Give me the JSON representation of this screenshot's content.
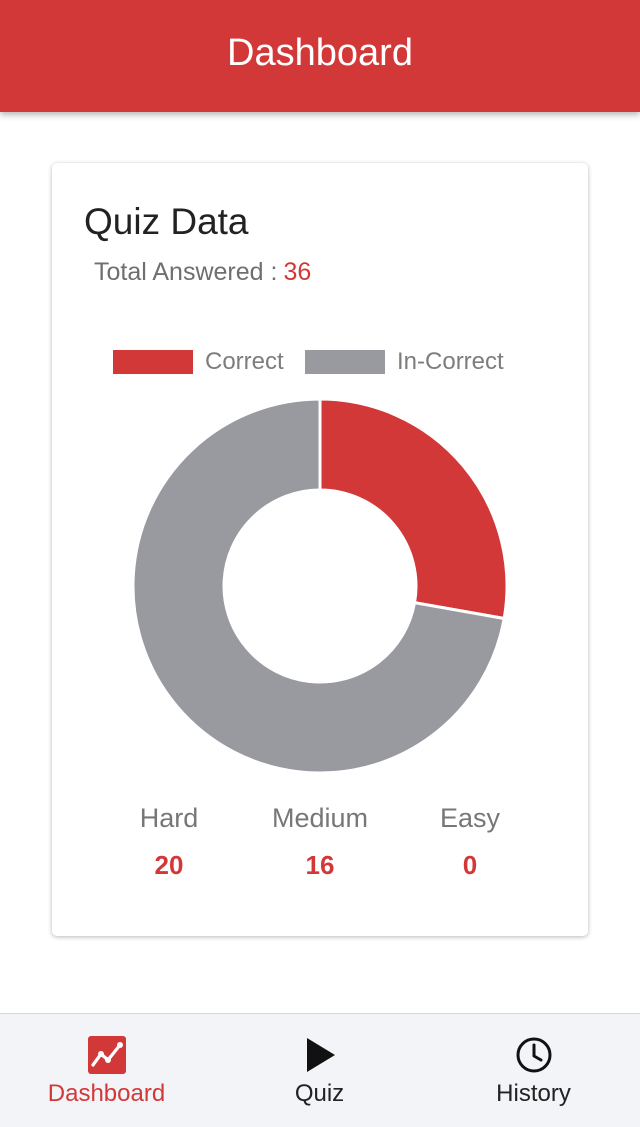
{
  "header": {
    "title": "Dashboard",
    "color": "#d33838"
  },
  "card": {
    "title": "Quiz Data",
    "total_label": "Total Answered :",
    "total_value": "36"
  },
  "chart_data": {
    "type": "pie",
    "variant": "doughnut",
    "title": "",
    "categories": [
      "Correct",
      "In-Correct"
    ],
    "values": [
      10,
      26
    ],
    "colors": [
      "#d33838",
      "#989aa0"
    ],
    "legend_position": "top"
  },
  "stats": [
    {
      "label": "Hard",
      "value": "20"
    },
    {
      "label": "Medium",
      "value": "16"
    },
    {
      "label": "Easy",
      "value": "0"
    }
  ],
  "tabbar": {
    "active": "Dashboard",
    "tabs": [
      {
        "label": "Dashboard",
        "icon": "chart-line-icon"
      },
      {
        "label": "Quiz",
        "icon": "play-icon"
      },
      {
        "label": "History",
        "icon": "clock-icon"
      }
    ]
  }
}
